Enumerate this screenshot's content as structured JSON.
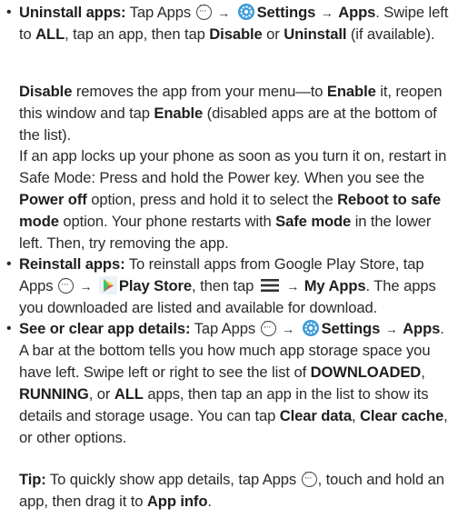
{
  "uninstall": {
    "title": "Uninstall apps:",
    "t1": " Tap Apps ",
    "settings": "Settings",
    "apps": "Apps",
    "t2": ". Swipe left to ",
    "all": "ALL",
    "t3": ", tap an app, then tap ",
    "disable": "Disable",
    "t4": " or ",
    "uninstall": "Uninstall",
    "t5": " (if available)."
  },
  "disable_para": {
    "disable": "Disable",
    "t1": " removes the app from your menu—to ",
    "enable": "Enable",
    "t2": " it, reopen this window and tap ",
    "enable2": "Enable",
    "t3": " (disabled apps are at the bottom of the list)."
  },
  "safe_mode_para": {
    "t1": "If an app locks up your phone as soon as you turn it on, restart in Safe Mode: Press and hold the Power key. When you see the ",
    "power_off": "Power off",
    "t2": " option, press and hold it to select the ",
    "reboot": "Reboot to safe mode",
    "t3": " option. Your phone restarts with ",
    "safe_mode": "Safe mode",
    "t4": " in the lower left. Then, try removing the app."
  },
  "reinstall": {
    "title": "Reinstall apps:",
    "t1": " To reinstall apps from Google Play Store, tap Apps ",
    "play_store": "Play Store",
    "t2": ", then tap ",
    "my_apps": "My Apps",
    "t3": ". The apps you downloaded are listed and available for download."
  },
  "details": {
    "title": "See or clear app details:",
    "t1": " Tap Apps ",
    "settings": "Settings",
    "apps": "Apps",
    "t2": ". A bar at the bottom tells you how much app storage space you have left. Swipe left or right to see the list of ",
    "downloaded": "DOWNLOADED",
    "c1": ", ",
    "running": "RUNNING",
    "c2": ", or ",
    "all": "ALL",
    "t3": " apps, then tap an app in the list to show its details and storage usage. You can tap ",
    "clear_data": "Clear data",
    "c3": ", ",
    "clear_cache": "Clear cache",
    "t4": ", or other options."
  },
  "tip": {
    "label": "Tip:",
    "t1": " To quickly show app details, tap Apps ",
    "t2": ", touch and hold an app, then drag it to ",
    "app_info": "App info",
    "t3": "."
  }
}
